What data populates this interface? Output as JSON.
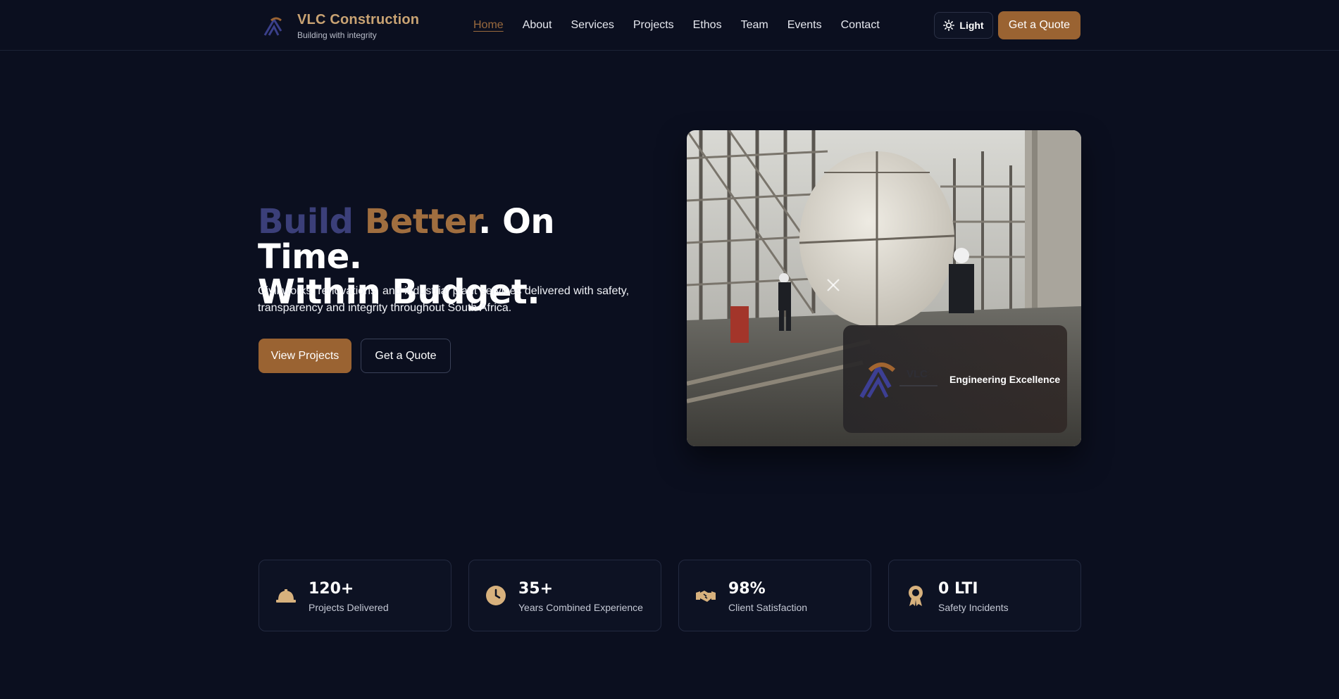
{
  "brand": {
    "name": "VLC Construction",
    "tagline": "Building with integrity"
  },
  "nav": {
    "items": [
      {
        "label": "Home",
        "active": true
      },
      {
        "label": "About"
      },
      {
        "label": "Services"
      },
      {
        "label": "Projects"
      },
      {
        "label": "Ethos"
      },
      {
        "label": "Team"
      },
      {
        "label": "Events"
      },
      {
        "label": "Contact"
      }
    ],
    "theme_toggle": "Light",
    "cta": "Get a Quote"
  },
  "hero": {
    "title_part1": "Build",
    "title_part2": "Better",
    "title_part3": ". On Time.",
    "title_line2": "Within Budget.",
    "description": "Civil works, renovations, and industrial plant services delivered with safety, transparency and integrity throughout South Africa.",
    "primary_button": "View Projects",
    "secondary_button": "Get a Quote",
    "card_caption": "Engineering Excellence",
    "card_logo_text": "VLC"
  },
  "stats": [
    {
      "value": "120+",
      "label": "Projects Delivered",
      "icon": "hard-hat-icon"
    },
    {
      "value": "35+",
      "label": "Years Combined Experience",
      "icon": "clock-icon"
    },
    {
      "value": "98%",
      "label": "Client Satisfaction",
      "icon": "handshake-icon"
    },
    {
      "value": "0 LTI",
      "label": "Safety Incidents",
      "icon": "award-icon"
    }
  ],
  "colors": {
    "background": "#0b0f1f",
    "accent": "#9a6332",
    "gold": "#c9a373",
    "navy": "#3b3f79"
  }
}
